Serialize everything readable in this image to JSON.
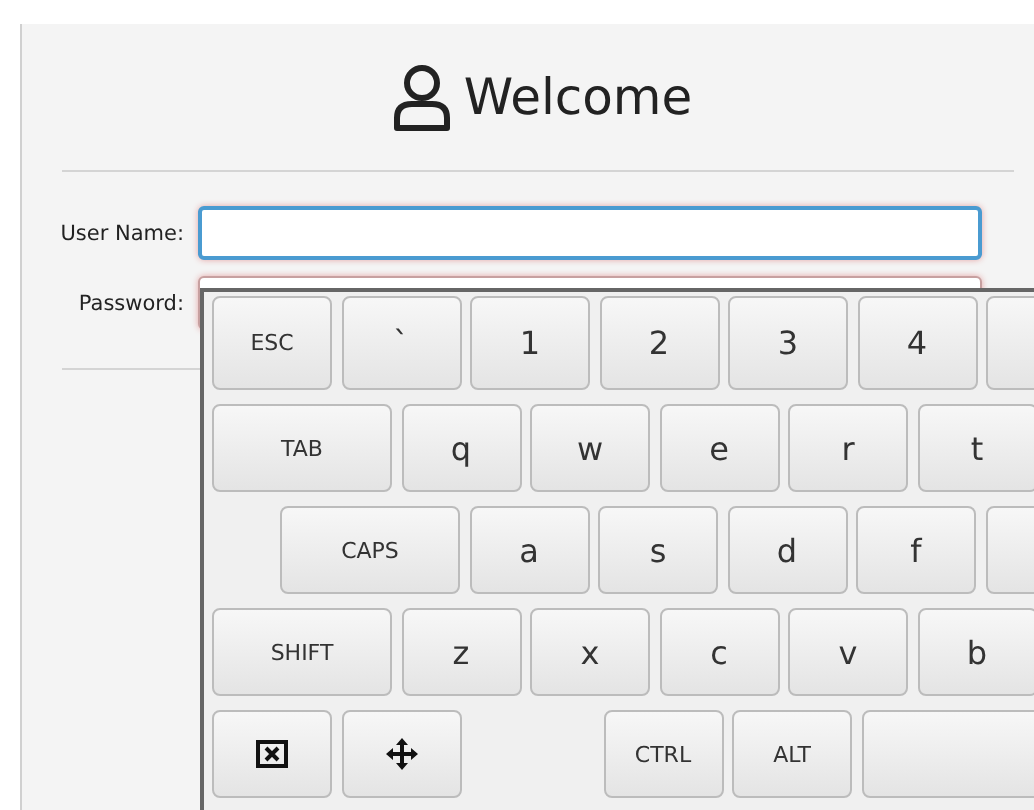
{
  "header": {
    "title": "Welcome"
  },
  "form": {
    "fields": [
      {
        "label": "User Name:",
        "focused": true
      },
      {
        "label": "Password:",
        "focused": false
      }
    ]
  },
  "keyboard": {
    "rows": [
      [
        {
          "kind": "fn",
          "label": "ESC"
        },
        {
          "kind": "char",
          "label": "`"
        },
        {
          "kind": "char",
          "label": "1"
        },
        {
          "kind": "char",
          "label": "2"
        },
        {
          "kind": "char",
          "label": "3"
        },
        {
          "kind": "char",
          "label": "4"
        },
        {
          "kind": "cut"
        }
      ],
      [
        {
          "kind": "wide",
          "label": "TAB"
        },
        {
          "kind": "char",
          "label": "q"
        },
        {
          "kind": "char",
          "label": "w"
        },
        {
          "kind": "char",
          "label": "e"
        },
        {
          "kind": "char",
          "label": "r"
        },
        {
          "kind": "char",
          "label": "t"
        }
      ],
      [
        {
          "kind": "wide",
          "label": "CAPS"
        },
        {
          "kind": "char",
          "label": "a"
        },
        {
          "kind": "char",
          "label": "s"
        },
        {
          "kind": "char",
          "label": "d"
        },
        {
          "kind": "char",
          "label": "f"
        },
        {
          "kind": "cut"
        }
      ],
      [
        {
          "kind": "wide",
          "label": "SHIFT"
        },
        {
          "kind": "char",
          "label": "z"
        },
        {
          "kind": "char",
          "label": "x"
        },
        {
          "kind": "char",
          "label": "c"
        },
        {
          "kind": "char",
          "label": "v"
        },
        {
          "kind": "char",
          "label": "b"
        }
      ],
      [
        {
          "kind": "backspace"
        },
        {
          "kind": "move"
        },
        {
          "kind": "gap"
        },
        {
          "kind": "fn",
          "label": "CTRL"
        },
        {
          "kind": "fn",
          "label": "ALT"
        },
        {
          "kind": "space"
        }
      ]
    ]
  }
}
